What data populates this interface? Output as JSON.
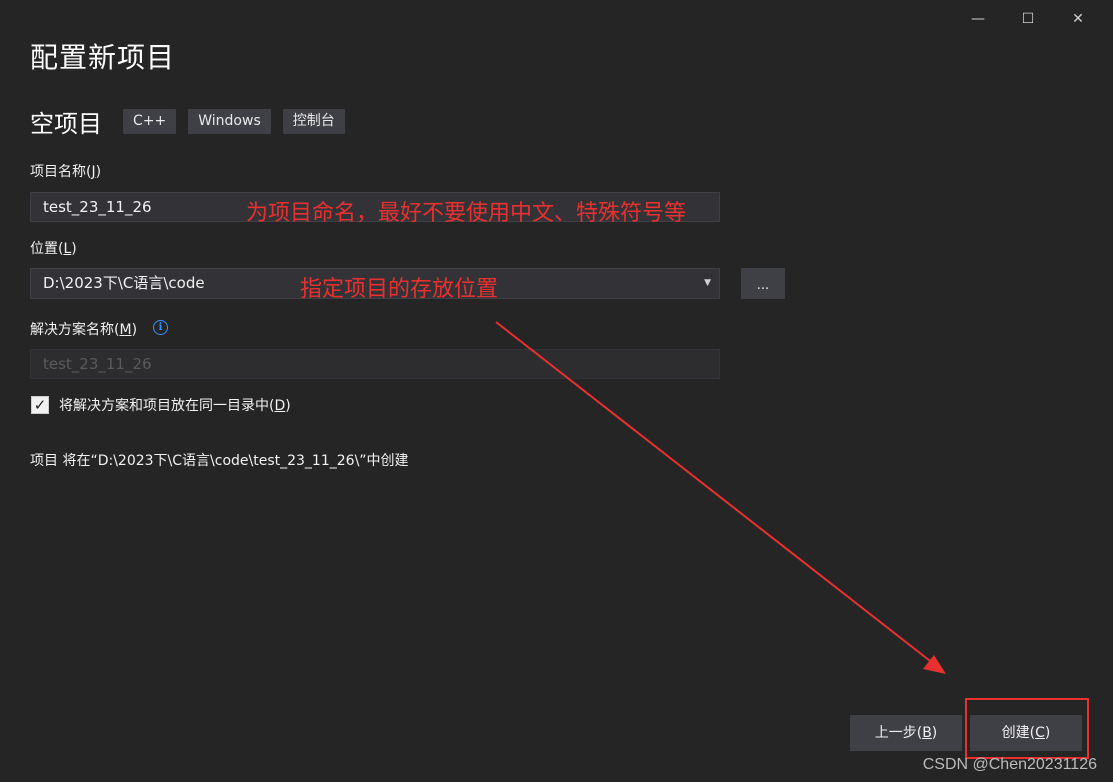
{
  "window": {
    "minimize": "—",
    "maximize": "☐",
    "close": "✕"
  },
  "page": {
    "title": "配置新项目"
  },
  "template": {
    "name": "空项目",
    "tags": [
      "C++",
      "Windows",
      "控制台"
    ]
  },
  "project_name": {
    "label": "项目名称(",
    "mnemonic": "J",
    "label_end": ")",
    "value": "test_23_11_26",
    "annotation": "为项目命名，最好不要使用中文、特殊符号等"
  },
  "location": {
    "label": "位置(",
    "mnemonic": "L",
    "label_end": ")",
    "value": "D:\\2023下\\C语言\\code",
    "browse_label": "...",
    "annotation": "指定项目的存放位置"
  },
  "solution_name": {
    "label": "解决方案名称(",
    "mnemonic": "M",
    "label_end": ")",
    "info_icon": "i",
    "value": "test_23_11_26"
  },
  "same_dir_option": {
    "checked_glyph": "✓",
    "label": "将解决方案和项目放在同一目录中(",
    "mnemonic": "D",
    "label_end": ")"
  },
  "path_note": "项目 将在“D:\\2023下\\C语言\\code\\test_23_11_26\\”中创建",
  "footer": {
    "back": {
      "label": "上一步(",
      "mnemonic": "B",
      "label_end": ")"
    },
    "create": {
      "label": "创建(",
      "mnemonic": "C",
      "label_end": ")"
    }
  },
  "colors": {
    "background": "#252526",
    "annotation": "#e8312f",
    "button": "#3f3f46",
    "info": "#3794ff"
  },
  "watermark": "CSDN @Chen20231126"
}
